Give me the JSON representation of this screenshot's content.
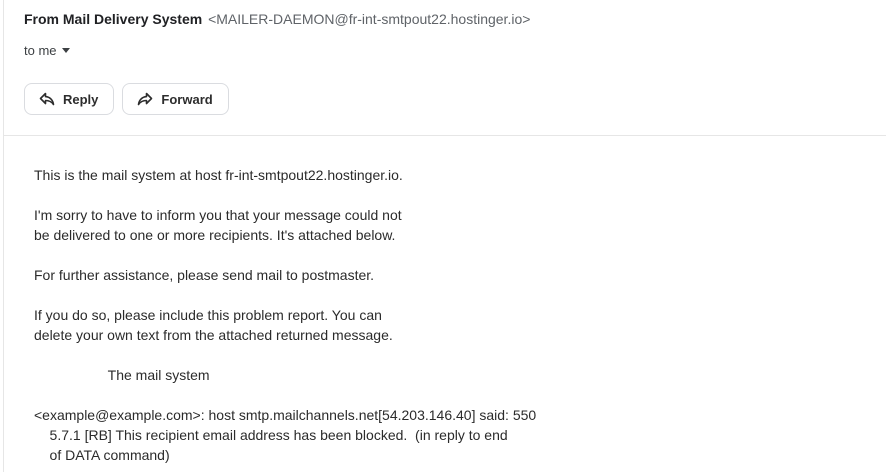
{
  "message": {
    "from_name": "From Mail Delivery System",
    "from_email": "<MAILER-DAEMON@fr-int-smtpout22.hostinger.io>",
    "to_label": "to me"
  },
  "actions": {
    "reply_label": "Reply",
    "forward_label": "Forward"
  },
  "body": {
    "line1": "This is the mail system at host fr-int-smtpout22.hostinger.io.",
    "line2": "I'm sorry to have to inform you that your message could not",
    "line3": "be delivered to one or more recipients. It's attached below.",
    "line4": "For further assistance, please send mail to postmaster.",
    "line5": "If you do so, please include this problem report. You can",
    "line6": "delete your own text from the attached returned message.",
    "line7": "                   The mail system",
    "line8": "<example@example.com>: host smtp.mailchannels.net[54.203.146.40] said: 550",
    "line9": "    5.7.1 [RB] This recipient email address has been blocked.  (in reply to end",
    "line10": "    of DATA command)"
  }
}
